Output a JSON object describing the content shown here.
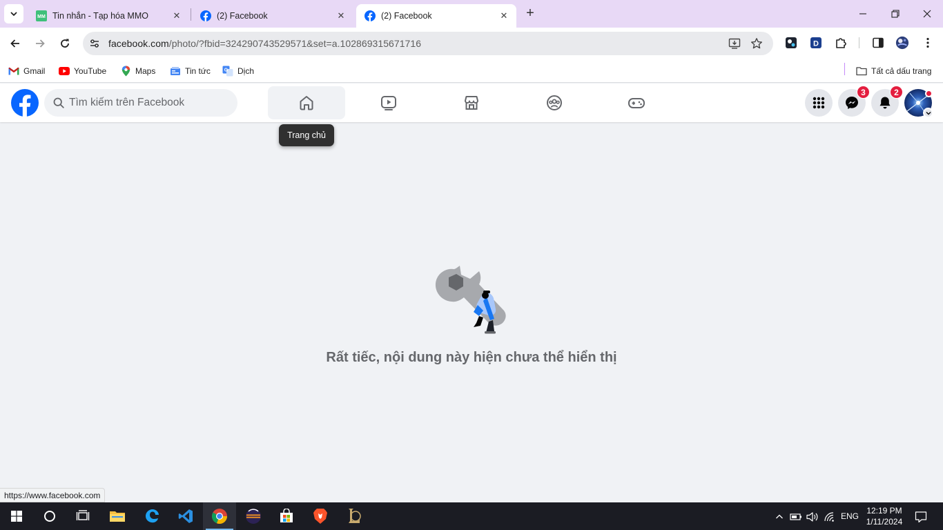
{
  "browser": {
    "tabs": [
      {
        "title": "Tin nhắn - Tạp hóa MMO",
        "favicon": "mmo-icon",
        "active": false
      },
      {
        "title": "(2) Facebook",
        "favicon": "facebook-icon",
        "active": false
      },
      {
        "title": "(2) Facebook",
        "favicon": "facebook-icon",
        "active": true
      }
    ],
    "address": {
      "host": "facebook.com",
      "path": "/photo/?fbid=324290743529571&set=a.102869315671716"
    },
    "bookmarks": [
      {
        "label": "Gmail",
        "icon": "gmail-icon"
      },
      {
        "label": "YouTube",
        "icon": "youtube-icon"
      },
      {
        "label": "Maps",
        "icon": "maps-icon"
      },
      {
        "label": "Tin tức",
        "icon": "news-icon"
      },
      {
        "label": "Dịch",
        "icon": "translate-icon"
      }
    ],
    "all_bookmarks_label": "Tất cả dấu trang",
    "status_url": "https://www.facebook.com"
  },
  "facebook": {
    "search_placeholder": "Tìm kiếm trên Facebook",
    "nav": [
      "home-icon",
      "watch-icon",
      "marketplace-icon",
      "groups-icon",
      "gaming-icon"
    ],
    "tooltip": "Trang chủ",
    "messenger_badge": "3",
    "notifications_badge": "2",
    "error_message": "Rất tiếc, nội dung này hiện chưa thể hiển thị"
  },
  "taskbar": {
    "language": "ENG",
    "time": "12:19 PM",
    "date": "1/11/2024"
  },
  "colors": {
    "facebook_blue": "#0866ff",
    "tabstrip": "#e8d9f6",
    "page_bg": "#f0f2f5",
    "badge_red": "#e41e3f",
    "taskbar": "#1b1c23"
  }
}
